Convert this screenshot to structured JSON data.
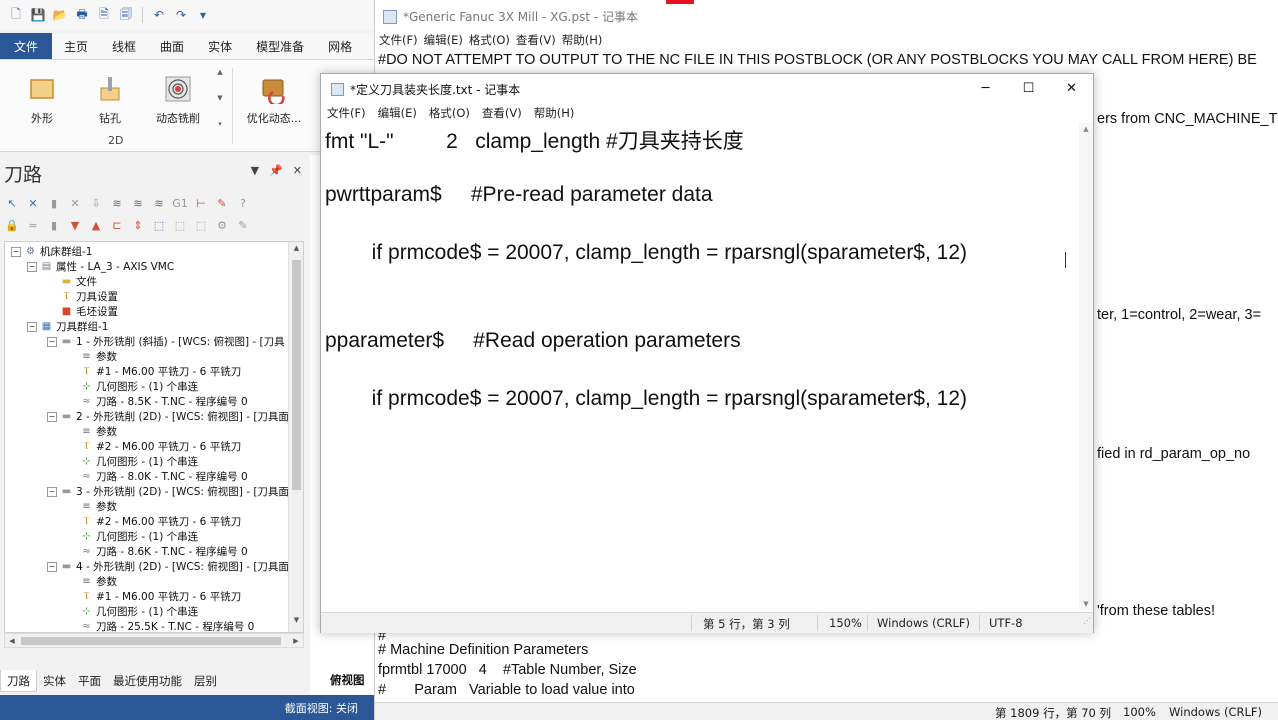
{
  "mastercam": {
    "ribbon_tabs": [
      "文件",
      "主页",
      "线框",
      "曲面",
      "实体",
      "模型准备",
      "网格"
    ],
    "ribbon_buttons": [
      "外形",
      "钻孔",
      "动态铣削",
      "优化动态..."
    ],
    "group_label": "2D",
    "panel_title": "刀路",
    "toolbar_row1": [
      "↖",
      "✕",
      "▮",
      "✕",
      "⇩",
      "≋",
      "≋",
      "≋",
      "G1",
      "⊢",
      "✎",
      "?"
    ],
    "toolbar_row2": [
      "🔒",
      "≈",
      "▮",
      "▼",
      "▲",
      "⊏",
      "⇕",
      "⬚",
      "⬚",
      "⬚",
      "⚙",
      "✎"
    ],
    "tree": [
      {
        "level": 0,
        "toggle": "−",
        "icon": "machine",
        "text": "机床群组-1"
      },
      {
        "level": 1,
        "toggle": "−",
        "icon": "props",
        "text": "属性 - LA_3 - AXIS VMC"
      },
      {
        "level": 2,
        "toggle": "",
        "icon": "folder",
        "text": "文件"
      },
      {
        "level": 2,
        "toggle": "",
        "icon": "tool",
        "text": "刀具设置"
      },
      {
        "level": 2,
        "toggle": "",
        "icon": "stock",
        "text": "毛坯设置"
      },
      {
        "level": 1,
        "toggle": "−",
        "icon": "group",
        "text": "刀具群组-1"
      },
      {
        "level": 2,
        "toggle": "−",
        "icon": "folder-gray",
        "text": "1 - 外形铣削 (斜插) - [WCS: 俯视图] - [刀具"
      },
      {
        "level": 3,
        "toggle": "",
        "icon": "params",
        "text": "参数"
      },
      {
        "level": 3,
        "toggle": "",
        "icon": "tool",
        "text": "#1 - M6.00 平铣刀 - 6 平铣刀"
      },
      {
        "level": 3,
        "toggle": "",
        "icon": "geom",
        "text": "几何图形 - (1) 个串连"
      },
      {
        "level": 3,
        "toggle": "",
        "icon": "path",
        "text": "刀路 - 8.5K - T.NC - 程序编号 0"
      },
      {
        "level": 2,
        "toggle": "−",
        "icon": "folder-gray",
        "text": "2 - 外形铣削 (2D) - [WCS: 俯视图] - [刀具面"
      },
      {
        "level": 3,
        "toggle": "",
        "icon": "params",
        "text": "参数"
      },
      {
        "level": 3,
        "toggle": "",
        "icon": "tool",
        "text": "#2 - M6.00 平铣刀 - 6 平铣刀"
      },
      {
        "level": 3,
        "toggle": "",
        "icon": "geom",
        "text": "几何图形 - (1) 个串连"
      },
      {
        "level": 3,
        "toggle": "",
        "icon": "path",
        "text": "刀路 - 8.0K - T.NC - 程序编号 0"
      },
      {
        "level": 2,
        "toggle": "−",
        "icon": "folder-gray",
        "text": "3 - 外形铣削 (2D) - [WCS: 俯视图] - [刀具面"
      },
      {
        "level": 3,
        "toggle": "",
        "icon": "params",
        "text": "参数"
      },
      {
        "level": 3,
        "toggle": "",
        "icon": "tool",
        "text": "#2 - M6.00 平铣刀 - 6 平铣刀"
      },
      {
        "level": 3,
        "toggle": "",
        "icon": "geom",
        "text": "几何图形 - (1) 个串连"
      },
      {
        "level": 3,
        "toggle": "",
        "icon": "path",
        "text": "刀路 - 8.6K - T.NC - 程序编号 0"
      },
      {
        "level": 2,
        "toggle": "−",
        "icon": "folder-gray",
        "text": "4 - 外形铣削 (2D) - [WCS: 俯视图] - [刀具面"
      },
      {
        "level": 3,
        "toggle": "",
        "icon": "params",
        "text": "参数"
      },
      {
        "level": 3,
        "toggle": "",
        "icon": "tool",
        "text": "#1 - M6.00 平铣刀 - 6 平铣刀"
      },
      {
        "level": 3,
        "toggle": "",
        "icon": "geom",
        "text": "几何图形 - (1) 个串连"
      },
      {
        "level": 3,
        "toggle": "",
        "icon": "path",
        "text": "刀路 - 25.5K - T.NC - 程序编号 0"
      }
    ],
    "bottom_tabs": [
      "刀路",
      "实体",
      "平面",
      "最近使用功能",
      "层别"
    ],
    "view_label": "俯视图",
    "status_text": "截面视图: 关闭",
    "accent": "#2b5797"
  },
  "bg_notepad": {
    "title": "*Generic Fanuc 3X Mill - XG.pst - 记事本",
    "menu": [
      "文件(F)",
      "编辑(E)",
      "格式(O)",
      "查看(V)",
      "帮助(H)"
    ],
    "line_top": "#DO NOT ATTEMPT TO OUTPUT TO THE NC FILE IN THIS POSTBLOCK (OR ANY POSTBLOCKS YOU MAY CALL FROM HERE) BE",
    "frag1": "ers from CNC_MACHINE_T",
    "frag2": "ter, 1=control, 2=wear, 3=",
    "frag3": "fied in rd_param_op_no",
    "frag4": "'from these tables!",
    "hash": "#",
    "lines_bottom": [
      "# Machine Definition Parameters",
      "fprmtbl 17000   4    #Table Number, Size",
      "#       Param   Variable to load value into"
    ],
    "status": {
      "pos": "第 1809 行，第 70 列",
      "zoom": "100%",
      "eol": "Windows (CRLF)"
    }
  },
  "fg_notepad": {
    "title": "*定义刀具装夹长度.txt - 记事本",
    "menu": [
      "文件(F)",
      "编辑(E)",
      "格式(O)",
      "查看(V)",
      "帮助(H)"
    ],
    "lines": [
      "fmt \"L-\"         2   clamp_length #刀具夹持长度",
      "pwrttparam$     #Pre-read parameter data",
      "        if prmcode$ = 20007, clamp_length = rparsngl(sparameter$, 12)",
      "pparameter$     #Read operation parameters",
      "        if prmcode$ = 20007, clamp_length = rparsngl(sparameter$, 12)"
    ],
    "status": {
      "pos": "第 5 行，第 3 列",
      "zoom": "150%",
      "eol": "Windows (CRLF)",
      "enc": "UTF-8"
    }
  }
}
